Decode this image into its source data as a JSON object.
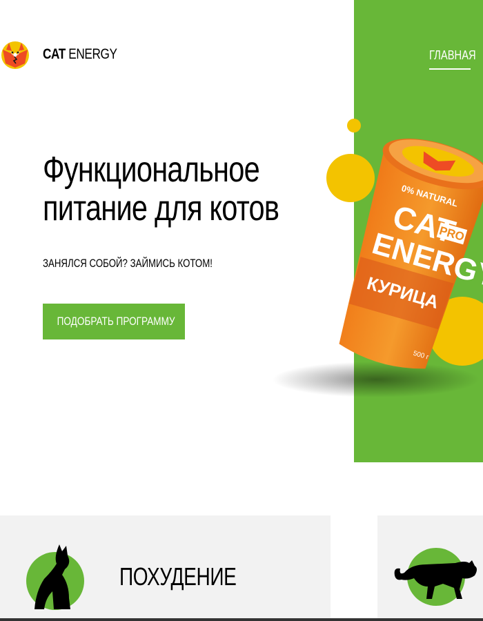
{
  "header": {
    "logo_text_bold": "CAT",
    "logo_text_light": "ENERGY",
    "nav": {
      "main_label": "ГЛАВНАЯ"
    }
  },
  "hero": {
    "title_line1": "Функциональное",
    "title_line2": "питание для котов",
    "tagline": "ЗАНЯЛСЯ СОБОЙ? ЗАЙМИСЬ КОТОМ!",
    "button_label": "ПОДОБРАТЬ ПРОГРАММУ"
  },
  "product": {
    "natural_label": "0% NATURAL",
    "brand_line1": "CAT",
    "brand_line2": "ENERGY",
    "pro_label": "PRO",
    "flavor": "КУРИЦА",
    "weight": "500 г"
  },
  "programs": [
    {
      "title": "ПОХУДЕНИЕ",
      "icon": "slim-cat-icon"
    },
    {
      "title": "",
      "icon": "panther-icon"
    }
  ],
  "colors": {
    "accent_green": "#68b738",
    "card_bg": "#f2f2f2",
    "pack_orange": "#ee8a1e",
    "yellow_circle": "#f3c300"
  }
}
